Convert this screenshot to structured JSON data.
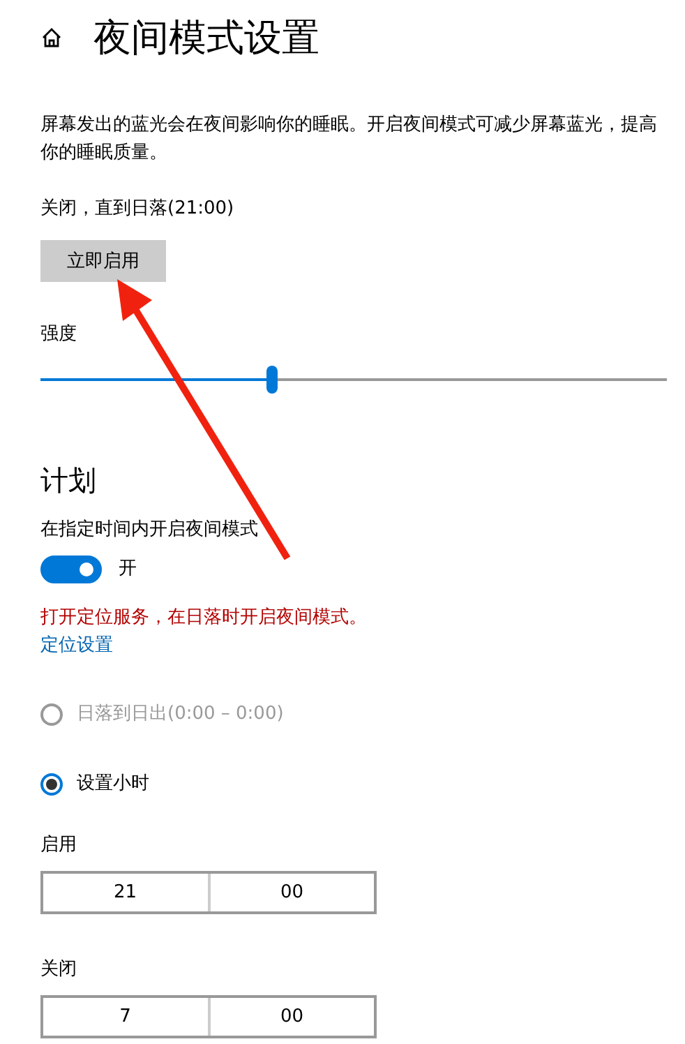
{
  "header": {
    "title": "夜间模式设置"
  },
  "description": "屏幕发出的蓝光会在夜间影响你的睡眠。开启夜间模式可减少屏幕蓝光，提高你的睡眠质量。",
  "status": "关闭，直到日落(21:00)",
  "enable_button": "立即启用",
  "strength": {
    "label": "强度",
    "level": 0.37
  },
  "schedule": {
    "heading": "计划",
    "toggle_label": "在指定时间内开启夜间模式",
    "on": true,
    "state_text": "开",
    "warning": "打开定位服务，在日落时开启夜间模式。",
    "link": "定位设置",
    "options": [
      {
        "label": "日落到日出(0:00 – 0:00)",
        "selected": false,
        "disabled": true
      },
      {
        "label": "设置小时",
        "selected": true,
        "disabled": false
      }
    ],
    "times": [
      {
        "label": "启用",
        "hour": "21",
        "minute": "00"
      },
      {
        "label": "关闭",
        "hour": "7",
        "minute": "00"
      }
    ]
  }
}
